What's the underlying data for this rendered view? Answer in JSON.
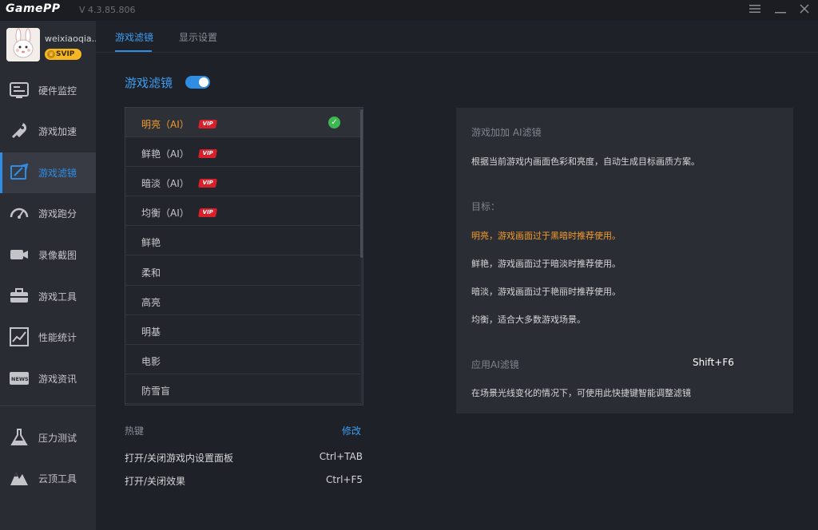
{
  "app": {
    "logo": "GamePP",
    "version": "V 4.3.85.806",
    "window_controls": [
      "menu-icon",
      "minimize-icon",
      "close-icon"
    ]
  },
  "user": {
    "name": "weixiaoqia..",
    "badge": "SVIP"
  },
  "sidebar": {
    "items": [
      {
        "label": "硬件监控",
        "icon": "hardware-monitor-icon"
      },
      {
        "label": "游戏加速",
        "icon": "rocket-icon"
      },
      {
        "label": "游戏滤镜",
        "icon": "filter-icon",
        "active": true
      },
      {
        "label": "游戏跑分",
        "icon": "speedometer-icon"
      },
      {
        "label": "录像截图",
        "icon": "camera-icon"
      },
      {
        "label": "游戏工具",
        "icon": "toolbox-icon"
      },
      {
        "label": "性能统计",
        "icon": "chart-icon"
      },
      {
        "label": "游戏资讯",
        "icon": "news-icon"
      }
    ],
    "bottom_items": [
      {
        "label": "压力测试",
        "icon": "flask-icon"
      },
      {
        "label": "云顶工具",
        "icon": "mountain-icon"
      }
    ]
  },
  "tabs": [
    {
      "label": "游戏滤镜",
      "active": true
    },
    {
      "label": "显示设置",
      "active": false
    }
  ],
  "filter": {
    "title": "游戏滤镜",
    "enabled": true,
    "items": [
      {
        "name": "明亮（AI）",
        "vip": "VIP",
        "selected": true
      },
      {
        "name": "鲜艳（AI）",
        "vip": "VIP"
      },
      {
        "name": "暗淡（AI）",
        "vip": "VIP"
      },
      {
        "name": "均衡（AI）",
        "vip": "VIP"
      },
      {
        "name": "鲜艳"
      },
      {
        "name": "柔和"
      },
      {
        "name": "高亮"
      },
      {
        "name": "明基"
      },
      {
        "name": "电影"
      },
      {
        "name": "防雪盲"
      }
    ]
  },
  "hotkeys": {
    "heading": "热键",
    "modify": "修改",
    "rows": [
      {
        "name": "打开/关闭游戏内设置面板",
        "key": "Ctrl+TAB"
      },
      {
        "name": "打开/关闭效果",
        "key": "Ctrl+F5"
      }
    ]
  },
  "info": {
    "title": "游戏加加 AI滤镜",
    "description": "根据当前游戏内画面色彩和亮度，自动生成目标画质方案。",
    "goal_heading": "目标：",
    "goals": [
      "明亮，游戏画面过于黑暗时推荐使用。",
      "鲜艳，游戏画面过于暗淡时推荐使用。",
      "暗淡，游戏画面过于艳丽时推荐使用。",
      "均衡，适合大多数游戏场景。"
    ],
    "apply_label": "应用AI滤镜",
    "apply_shortcut": "Shift+F6",
    "apply_note": "在场景光线变化的情况下，可使用此快捷键智能调整滤镜"
  },
  "colors": {
    "accent": "#2f8de4",
    "selected_text": "#f39c2b",
    "vip": "#d8202a",
    "check": "#3cb851",
    "svip": "#f5b624"
  }
}
